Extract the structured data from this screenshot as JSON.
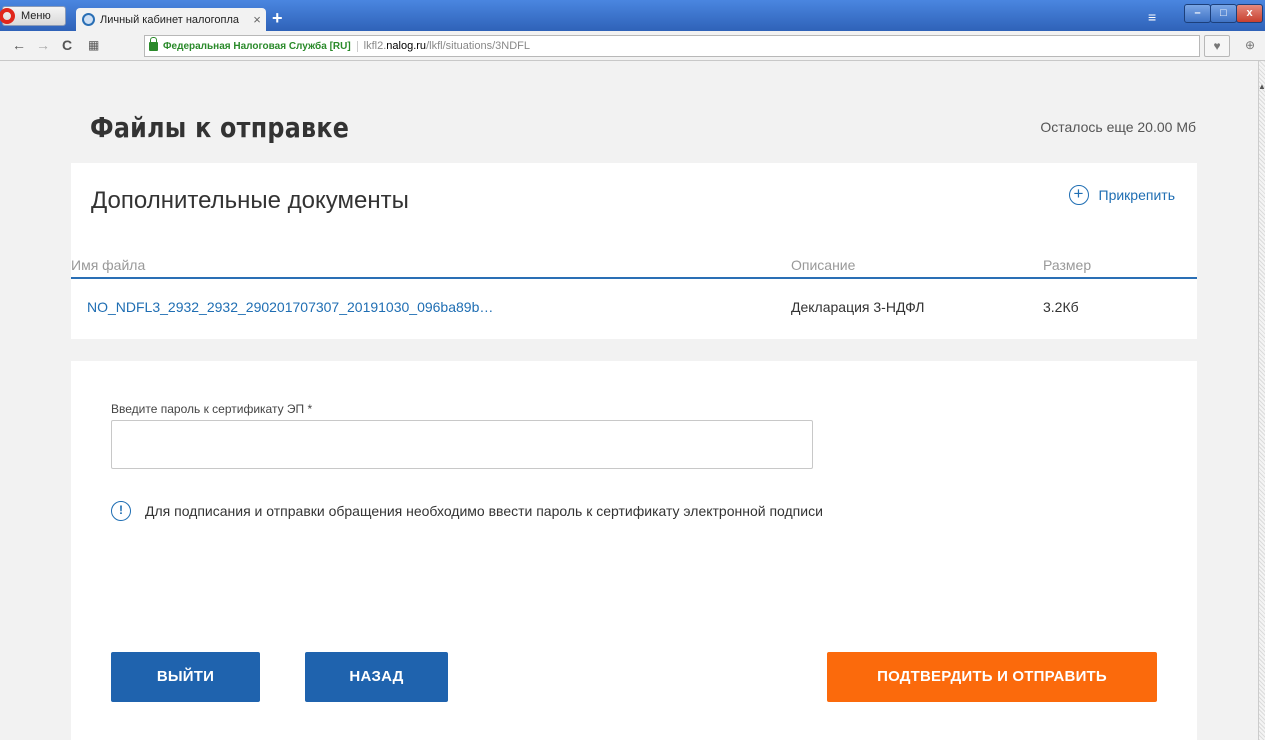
{
  "browser": {
    "menu_label": "Меню",
    "tab_title": "Личный кабинет налогопла",
    "site_identity": "Федеральная Налоговая Служба [RU]",
    "url_prefix": "lkfl2.",
    "url_domain": "nalog.ru",
    "url_path": "/lkfl/situations/3NDFL"
  },
  "header": {
    "title": "Файлы к отправке",
    "quota": "Осталось еще 20.00 Мб"
  },
  "documents": {
    "title": "Дополнительные документы",
    "attach_label": "Прикрепить",
    "columns": [
      "Имя файла",
      "Описание",
      "Размер"
    ],
    "rows": [
      {
        "name": "NO_NDFL3_2932_2932_290201707307_20191030_096ba89b…",
        "description": "Декларация 3-НДФЛ",
        "size": "3.2Кб"
      }
    ]
  },
  "signing": {
    "password_label": "Введите пароль к сертификату ЭП *",
    "password_value": "",
    "hint": "Для подписания и отправки обращения необходимо ввести пароль к сертификату электронной подписи"
  },
  "actions": {
    "exit": "ВЫЙТИ",
    "back": "НАЗАД",
    "confirm": "ПОДТВЕРДИТЬ И ОТПРАВИТЬ"
  },
  "colors": {
    "primary": "#1f63ae",
    "accent": "#fb6a0c"
  }
}
